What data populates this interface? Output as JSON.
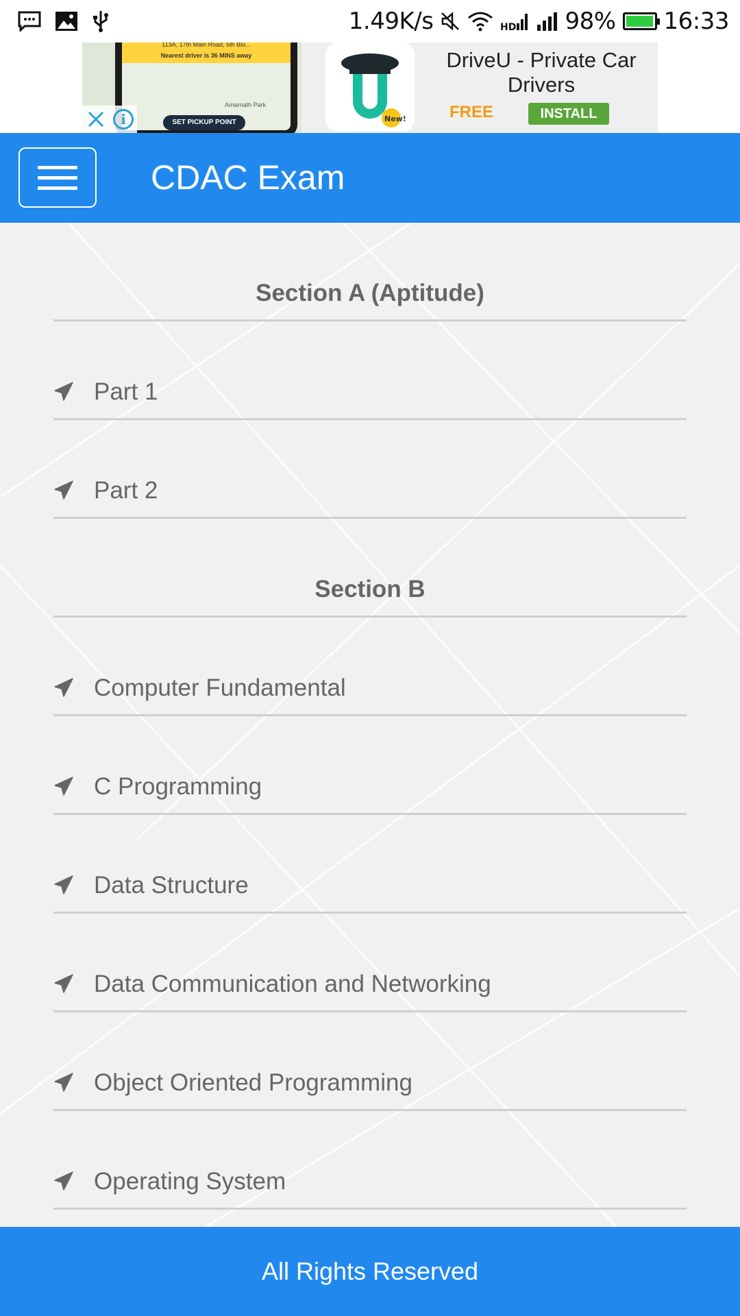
{
  "status_bar": {
    "net_speed": "1.49K/s",
    "battery_percent": "98%",
    "battery_level": 0.98,
    "time": "16:33",
    "left_icons": [
      "message-icon",
      "image-icon",
      "usb-icon"
    ],
    "right_icons": [
      "mute-icon",
      "wifi-icon",
      "hd-signal-icon",
      "signal-icon",
      "battery-icon"
    ]
  },
  "ad": {
    "title": "DriveU - Private Car Drivers",
    "free_label": "FREE",
    "install_label": "INSTALL",
    "map_address": "113A, 17th Main Road, 5th Blo...",
    "map_notice": "Nearest driver is 36 MINS away",
    "map_area": "Amarnath Park",
    "pickup_label": "SET PICKUP POINT",
    "badge": "New!"
  },
  "app_bar": {
    "title": "CDAC Exam",
    "menu_icon": "hamburger-menu-icon"
  },
  "sections": [
    {
      "title": "Section A (Aptitude)",
      "items": [
        "Part 1",
        "Part 2"
      ]
    },
    {
      "title": "Section B",
      "items": [
        "Computer Fundamental",
        "C Programming",
        "Data Structure",
        "Data Communication and Networking",
        "Object Oriented Programming",
        "Operating System"
      ]
    }
  ],
  "footer": {
    "text": "All Rights Reserved"
  },
  "colors": {
    "primary": "#2189ee",
    "text_muted": "#666666",
    "divider": "#cfcfcf"
  }
}
